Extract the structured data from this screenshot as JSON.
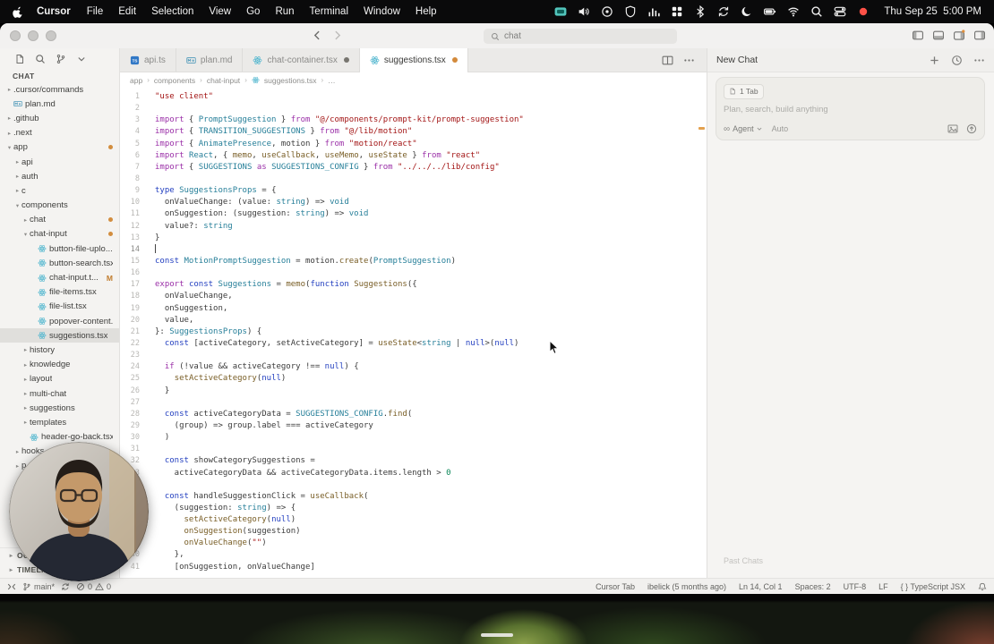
{
  "menubar": {
    "app_name": "Cursor",
    "menus": [
      "File",
      "Edit",
      "Selection",
      "View",
      "Go",
      "Run",
      "Terminal",
      "Window",
      "Help"
    ],
    "status_icons": [
      "screen-share-icon",
      "volume-icon",
      "circle-icon",
      "shield-icon",
      "stats-icon",
      "grid-icon",
      "bluetooth-icon",
      "sync-icon",
      "moon-icon",
      "battery-icon",
      "wifi-icon",
      "spotlight-icon",
      "control-center-icon",
      "record-icon"
    ],
    "clock": "Thu Sep 25  5:00 PM"
  },
  "titlebar": {
    "search_value": "chat",
    "right_icons": [
      "panel-left-icon",
      "panel-bottom-icon",
      "panel-right-badge-icon",
      "panel-right-icon"
    ]
  },
  "sidebar": {
    "toolbar_icons": [
      "new-file-icon",
      "search-icon",
      "git-branch-icon",
      "chevron-down-icon"
    ],
    "section_title": "CHAT",
    "items": [
      {
        "label": ".cursor/commands",
        "depth": 0,
        "kind": "folder"
      },
      {
        "label": "plan.md",
        "depth": 0,
        "kind": "file",
        "icon": "md"
      },
      {
        "label": ".github",
        "depth": 0,
        "kind": "folder"
      },
      {
        "label": ".next",
        "depth": 0,
        "kind": "folder"
      },
      {
        "label": "app",
        "depth": 0,
        "kind": "folder",
        "expanded": true,
        "badge": "dot"
      },
      {
        "label": "api",
        "depth": 1,
        "kind": "folder"
      },
      {
        "label": "auth",
        "depth": 1,
        "kind": "folder"
      },
      {
        "label": "c",
        "depth": 1,
        "kind": "folder"
      },
      {
        "label": "components",
        "depth": 1,
        "kind": "folder",
        "expanded": true
      },
      {
        "label": "chat",
        "depth": 2,
        "kind": "folder",
        "badge": "dot"
      },
      {
        "label": "chat-input",
        "depth": 2,
        "kind": "folder",
        "expanded": true,
        "badge": "dot"
      },
      {
        "label": "button-file-uplo...",
        "depth": 3,
        "kind": "file",
        "icon": "react"
      },
      {
        "label": "button-search.tsx",
        "depth": 3,
        "kind": "file",
        "icon": "react"
      },
      {
        "label": "chat-input.t...",
        "depth": 3,
        "kind": "file",
        "icon": "react",
        "badge": "M"
      },
      {
        "label": "file-items.tsx",
        "depth": 3,
        "kind": "file",
        "icon": "react"
      },
      {
        "label": "file-list.tsx",
        "depth": 3,
        "kind": "file",
        "icon": "react"
      },
      {
        "label": "popover-content...",
        "depth": 3,
        "kind": "file",
        "icon": "react"
      },
      {
        "label": "suggestions.tsx",
        "depth": 3,
        "kind": "file",
        "icon": "react",
        "selected": true
      },
      {
        "label": "history",
        "depth": 2,
        "kind": "folder"
      },
      {
        "label": "knowledge",
        "depth": 2,
        "kind": "folder"
      },
      {
        "label": "layout",
        "depth": 2,
        "kind": "folder"
      },
      {
        "label": "multi-chat",
        "depth": 2,
        "kind": "folder"
      },
      {
        "label": "suggestions",
        "depth": 2,
        "kind": "folder"
      },
      {
        "label": "templates",
        "depth": 2,
        "kind": "folder"
      },
      {
        "label": "header-go-back.tsx",
        "depth": 2,
        "kind": "file",
        "icon": "react"
      },
      {
        "label": "hooks",
        "depth": 1,
        "kind": "folder"
      },
      {
        "label": "p",
        "depth": 1,
        "kind": "folder"
      }
    ],
    "bottom_sections": [
      "OUTLINE",
      "TIMELINE"
    ]
  },
  "tabs": [
    {
      "label": "api.ts",
      "icon": "ts",
      "active": false,
      "modified": false
    },
    {
      "label": "plan.md",
      "icon": "md",
      "active": false,
      "modified": false
    },
    {
      "label": "chat-container.tsx",
      "icon": "react",
      "active": false,
      "modified": true
    },
    {
      "label": "suggestions.tsx",
      "icon": "react",
      "active": true,
      "modified": true
    }
  ],
  "tab_actions": [
    "split-editor-icon",
    "more-actions-icon"
  ],
  "editor": {
    "breadcrumb": [
      {
        "label": "app"
      },
      {
        "label": "components"
      },
      {
        "label": "chat-input"
      },
      {
        "label": "suggestions.tsx",
        "icon": "react"
      },
      {
        "label": "…"
      }
    ],
    "lines": [
      {
        "n": 1,
        "t": [
          [
            "s",
            "\"use client\""
          ]
        ]
      },
      {
        "n": 2,
        "t": []
      },
      {
        "n": 3,
        "t": [
          [
            "k",
            "import"
          ],
          [
            "p",
            " { "
          ],
          [
            "t",
            "PromptSuggestion"
          ],
          [
            "p",
            " } "
          ],
          [
            "k",
            "from"
          ],
          [
            "p",
            " "
          ],
          [
            "s",
            "\"@/components/prompt-kit/prompt-suggestion\""
          ]
        ]
      },
      {
        "n": 4,
        "t": [
          [
            "k",
            "import"
          ],
          [
            "p",
            " { "
          ],
          [
            "t",
            "TRANSITION_SUGGESTIONS"
          ],
          [
            "p",
            " } "
          ],
          [
            "k",
            "from"
          ],
          [
            "p",
            " "
          ],
          [
            "s",
            "\"@/lib/motion\""
          ]
        ]
      },
      {
        "n": 5,
        "t": [
          [
            "k",
            "import"
          ],
          [
            "p",
            " { "
          ],
          [
            "t",
            "AnimatePresence"
          ],
          [
            "p",
            ", motion } "
          ],
          [
            "k",
            "from"
          ],
          [
            "p",
            " "
          ],
          [
            "s",
            "\"motion/react\""
          ]
        ]
      },
      {
        "n": 6,
        "t": [
          [
            "k",
            "import"
          ],
          [
            "p",
            " "
          ],
          [
            "t",
            "React"
          ],
          [
            "p",
            ", { "
          ],
          [
            "f",
            "memo"
          ],
          [
            "p",
            ", "
          ],
          [
            "f",
            "useCallback"
          ],
          [
            "p",
            ", "
          ],
          [
            "f",
            "useMemo"
          ],
          [
            "p",
            ", "
          ],
          [
            "f",
            "useState"
          ],
          [
            "p",
            " } "
          ],
          [
            "k",
            "from"
          ],
          [
            "p",
            " "
          ],
          [
            "s",
            "\"react\""
          ]
        ]
      },
      {
        "n": 7,
        "t": [
          [
            "k",
            "import"
          ],
          [
            "p",
            " { "
          ],
          [
            "t",
            "SUGGESTIONS"
          ],
          [
            "p",
            " "
          ],
          [
            "k",
            "as"
          ],
          [
            "p",
            " "
          ],
          [
            "t",
            "SUGGESTIONS_CONFIG"
          ],
          [
            "p",
            " } "
          ],
          [
            "k",
            "from"
          ],
          [
            "p",
            " "
          ],
          [
            "s",
            "\"../../../lib/config\""
          ]
        ]
      },
      {
        "n": 8,
        "t": []
      },
      {
        "n": 9,
        "t": [
          [
            "d",
            "type"
          ],
          [
            "p",
            " "
          ],
          [
            "t",
            "SuggestionsProps"
          ],
          [
            "p",
            " = {"
          ]
        ]
      },
      {
        "n": 10,
        "t": [
          [
            "p",
            "  onValueChange: (value: "
          ],
          [
            "t",
            "string"
          ],
          [
            "p",
            ") => "
          ],
          [
            "t",
            "void"
          ]
        ]
      },
      {
        "n": 11,
        "t": [
          [
            "p",
            "  onSuggestion: (suggestion: "
          ],
          [
            "t",
            "string"
          ],
          [
            "p",
            ") => "
          ],
          [
            "t",
            "void"
          ]
        ]
      },
      {
        "n": 12,
        "t": [
          [
            "p",
            "  value?: "
          ],
          [
            "t",
            "string"
          ]
        ]
      },
      {
        "n": 13,
        "t": [
          [
            "p",
            "}"
          ]
        ]
      },
      {
        "n": 14,
        "t": [],
        "caret": true
      },
      {
        "n": 15,
        "t": [
          [
            "d",
            "const"
          ],
          [
            "p",
            " "
          ],
          [
            "t",
            "MotionPromptSuggestion"
          ],
          [
            "p",
            " = motion."
          ],
          [
            "f",
            "create"
          ],
          [
            "p",
            "("
          ],
          [
            "t",
            "PromptSuggestion"
          ],
          [
            "p",
            ")"
          ]
        ]
      },
      {
        "n": 16,
        "t": []
      },
      {
        "n": 17,
        "t": [
          [
            "k",
            "export"
          ],
          [
            "p",
            " "
          ],
          [
            "d",
            "const"
          ],
          [
            "p",
            " "
          ],
          [
            "t",
            "Suggestions"
          ],
          [
            "p",
            " = "
          ],
          [
            "f",
            "memo"
          ],
          [
            "p",
            "("
          ],
          [
            "d",
            "function"
          ],
          [
            "p",
            " "
          ],
          [
            "f",
            "Suggestions"
          ],
          [
            "p",
            "({"
          ]
        ]
      },
      {
        "n": 18,
        "t": [
          [
            "p",
            "  onValueChange,"
          ]
        ]
      },
      {
        "n": 19,
        "t": [
          [
            "p",
            "  onSuggestion,"
          ]
        ]
      },
      {
        "n": 20,
        "t": [
          [
            "p",
            "  value,"
          ]
        ]
      },
      {
        "n": 21,
        "t": [
          [
            "p",
            "}: "
          ],
          [
            "t",
            "SuggestionsProps"
          ],
          [
            "p",
            ") {"
          ]
        ]
      },
      {
        "n": 22,
        "t": [
          [
            "p",
            "  "
          ],
          [
            "d",
            "const"
          ],
          [
            "p",
            " [activeCategory, setActiveCategory] = "
          ],
          [
            "f",
            "useState"
          ],
          [
            "p",
            "<"
          ],
          [
            "t",
            "string"
          ],
          [
            "p",
            " | "
          ],
          [
            "d",
            "null"
          ],
          [
            "p",
            ">("
          ],
          [
            "d",
            "null"
          ],
          [
            "p",
            ")"
          ]
        ]
      },
      {
        "n": 23,
        "t": []
      },
      {
        "n": 24,
        "t": [
          [
            "p",
            "  "
          ],
          [
            "k",
            "if"
          ],
          [
            "p",
            " (!value && activeCategory !== "
          ],
          [
            "d",
            "null"
          ],
          [
            "p",
            ") {"
          ]
        ]
      },
      {
        "n": 25,
        "t": [
          [
            "p",
            "    "
          ],
          [
            "f",
            "setActiveCategory"
          ],
          [
            "p",
            "("
          ],
          [
            "d",
            "null"
          ],
          [
            "p",
            ")"
          ]
        ]
      },
      {
        "n": 26,
        "t": [
          [
            "p",
            "  }"
          ]
        ]
      },
      {
        "n": 27,
        "t": []
      },
      {
        "n": 28,
        "t": [
          [
            "p",
            "  "
          ],
          [
            "d",
            "const"
          ],
          [
            "p",
            " activeCategoryData = "
          ],
          [
            "t",
            "SUGGESTIONS_CONFIG"
          ],
          [
            "p",
            "."
          ],
          [
            "f",
            "find"
          ],
          [
            "p",
            "("
          ]
        ]
      },
      {
        "n": 29,
        "t": [
          [
            "p",
            "    (group) => group.label === activeCategory"
          ]
        ]
      },
      {
        "n": 30,
        "t": [
          [
            "p",
            "  )"
          ]
        ]
      },
      {
        "n": 31,
        "t": []
      },
      {
        "n": 32,
        "t": [
          [
            "p",
            "  "
          ],
          [
            "d",
            "const"
          ],
          [
            "p",
            " showCategorySuggestions ="
          ]
        ]
      },
      {
        "n": 33,
        "t": [
          [
            "p",
            "    activeCategoryData && activeCategoryData.items.length > "
          ],
          [
            "n",
            "0"
          ]
        ]
      },
      {
        "n": 34,
        "t": []
      },
      {
        "n": 35,
        "t": [
          [
            "p",
            "  "
          ],
          [
            "d",
            "const"
          ],
          [
            "p",
            " handleSuggestionClick = "
          ],
          [
            "f",
            "useCallback"
          ],
          [
            "p",
            "("
          ]
        ]
      },
      {
        "n": 36,
        "t": [
          [
            "p",
            "    (suggestion: "
          ],
          [
            "t",
            "string"
          ],
          [
            "p",
            ") => {"
          ]
        ]
      },
      {
        "n": 37,
        "t": [
          [
            "p",
            "      "
          ],
          [
            "f",
            "setActiveCategory"
          ],
          [
            "p",
            "("
          ],
          [
            "d",
            "null"
          ],
          [
            "p",
            ")"
          ]
        ]
      },
      {
        "n": 38,
        "t": [
          [
            "p",
            "      "
          ],
          [
            "f",
            "onSuggestion"
          ],
          [
            "p",
            "(suggestion)"
          ]
        ]
      },
      {
        "n": 39,
        "t": [
          [
            "p",
            "      "
          ],
          [
            "f",
            "onValueChange"
          ],
          [
            "p",
            "("
          ],
          [
            "s",
            "\"\""
          ],
          [
            "p",
            ")"
          ]
        ]
      },
      {
        "n": 40,
        "t": [
          [
            "p",
            "    },"
          ]
        ]
      },
      {
        "n": 41,
        "t": [
          [
            "p",
            "    [onSuggestion, onValueChange]"
          ]
        ]
      }
    ]
  },
  "chat_panel": {
    "title": "New Chat",
    "header_icons": [
      "plus-icon",
      "history-icon",
      "ellipsis-icon"
    ],
    "tab_chip": "1 Tab",
    "placeholder": "Plan, search, build anything",
    "agent_symbol": "∞",
    "agent_label": "Agent",
    "model_label": "Auto",
    "input_icons": [
      "image-icon",
      "send-icon"
    ],
    "footer": "Past Chats"
  },
  "statusbar": {
    "branch": "main*",
    "errors": "0",
    "warnings": "0",
    "right_items": [
      "Cursor Tab",
      "ibelick (5 months ago)",
      "Ln 14, Col 1",
      "Spaces: 2",
      "UTF-8",
      "LF",
      "{ } TypeScript JSX"
    ]
  }
}
